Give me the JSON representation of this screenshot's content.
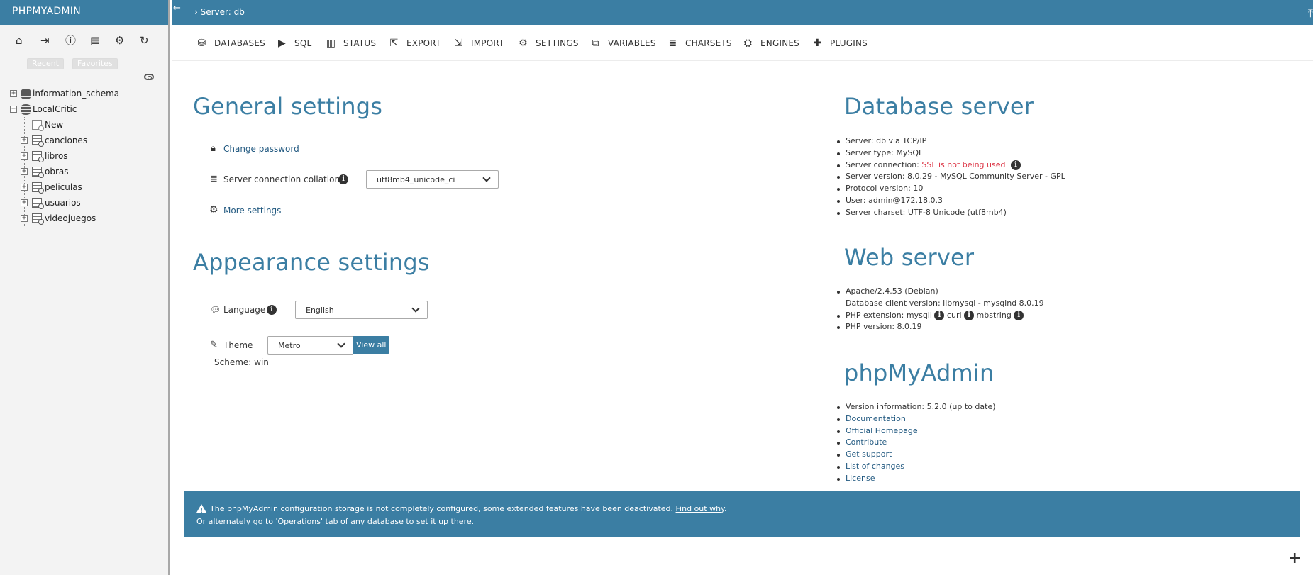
{
  "sidebar": {
    "logo": "PHPMYADMIN",
    "collapse_arrow": "←",
    "icons": [
      "home-icon",
      "logout-icon",
      "info-icon",
      "docs-icon",
      "settings-icon",
      "reload-icon"
    ],
    "recent_label": "Recent",
    "favorites_label": "Favorites",
    "databases": [
      {
        "name": "information_schema",
        "expanded": false
      },
      {
        "name": "LocalCritic",
        "expanded": true
      }
    ],
    "new_label": "New",
    "tables": [
      "canciones",
      "libros",
      "obras",
      "peliculas",
      "usuarios",
      "videojuegos"
    ]
  },
  "topbar": {
    "breadcrumb": "› Server: db"
  },
  "tabs": [
    {
      "label": "DATABASES",
      "icon": "database-icon"
    },
    {
      "label": "SQL",
      "icon": "play-icon"
    },
    {
      "label": "STATUS",
      "icon": "status-icon"
    },
    {
      "label": "EXPORT",
      "icon": "export-icon"
    },
    {
      "label": "IMPORT",
      "icon": "import-icon"
    },
    {
      "label": "SETTINGS",
      "icon": "gear-icon"
    },
    {
      "label": "VARIABLES",
      "icon": "variables-icon"
    },
    {
      "label": "CHARSETS",
      "icon": "charsets-icon"
    },
    {
      "label": "ENGINES",
      "icon": "engines-icon"
    },
    {
      "label": "PLUGINS",
      "icon": "plugins-icon"
    }
  ],
  "general": {
    "title": "General settings",
    "change_password": "Change password",
    "collation_label": "Server connection collation:",
    "collation_value": "utf8mb4_unicode_ci",
    "more_settings": "More settings"
  },
  "appearance": {
    "title": "Appearance settings",
    "language_label": "Language",
    "language_value": "English",
    "theme_label": "Theme",
    "theme_value": "Metro",
    "view_all": "View all",
    "scheme": "Scheme: win"
  },
  "database_server": {
    "title": "Database server",
    "server": "Server: db via TCP/IP",
    "type": "Server type: MySQL",
    "connection_label": "Server connection: ",
    "connection_value": "SSL is not being used",
    "version": "Server version: 8.0.29 - MySQL Community Server - GPL",
    "protocol": "Protocol version: 10",
    "user": "User: admin@172.18.0.3",
    "charset": "Server charset: UTF-8 Unicode (utf8mb4)"
  },
  "web_server": {
    "title": "Web server",
    "apache": "Apache/2.4.53 (Debian)",
    "client": "Database client version: libmysql - mysqlnd 8.0.19",
    "php_ext_label": "PHP extension: mysqli",
    "php_ext_curl": "curl",
    "php_ext_mbstring": "mbstring",
    "php_version": "PHP version: 8.0.19"
  },
  "phpmyadmin": {
    "title": "phpMyAdmin",
    "version": "Version information: 5.2.0 (up to date)",
    "links": [
      "Documentation",
      "Official Homepage",
      "Contribute",
      "Get support",
      "List of changes",
      "License"
    ]
  },
  "notice": {
    "line1": "The phpMyAdmin configuration storage is not completely configured, some extended features have been deactivated.",
    "link": "Find out why",
    "line2": "Or alternately go to 'Operations' tab of any database to set it up there."
  },
  "colors": {
    "brand": "#3b7ea3",
    "link": "#235a81",
    "warning": "#dc3545",
    "sidebar_bg": "#f3f3f3"
  }
}
